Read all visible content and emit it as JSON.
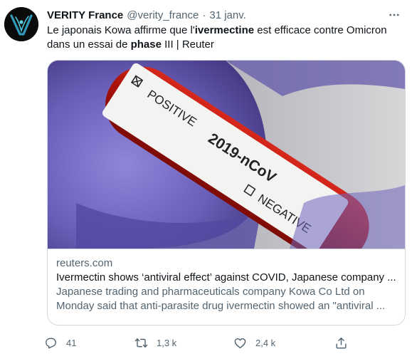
{
  "tweet": {
    "author_name": "VERITY France",
    "handle": "@verity_france",
    "separator": "·",
    "date": "31 janv.",
    "text_parts": [
      {
        "t": "Le japonais Kowa affirme que l'",
        "bold": false
      },
      {
        "t": "ivermectine",
        "bold": true
      },
      {
        "t": " est efficace contre Omicron dans un essai de ",
        "bold": false
      },
      {
        "t": "phase",
        "bold": true
      },
      {
        "t": " III | Reuter",
        "bold": false
      }
    ]
  },
  "card": {
    "image_labels": {
      "top": "2019-nCoV",
      "positive": "POSITIVE",
      "negative": "NEGATIVE"
    },
    "domain": "reuters.com",
    "title": "Ivermectin shows ‘antiviral effect’ against COVID, Japanese company ...",
    "description": "Japanese trading and pharmaceuticals company Kowa Co Ltd on Monday said that anti-parasite drug ivermectin showed an \"antiviral ..."
  },
  "actions": {
    "reply": {
      "icon": "reply-icon",
      "count": "41"
    },
    "retweet": {
      "icon": "retweet-icon",
      "count": "1,3 k"
    },
    "like": {
      "icon": "like-icon",
      "count": "2,4 k"
    },
    "share": {
      "icon": "share-icon"
    }
  },
  "colors": {
    "secondary_text": "#536471",
    "border": "#cfd9de",
    "tube_red": "#b8170e",
    "glove": "#6a5fb8"
  }
}
